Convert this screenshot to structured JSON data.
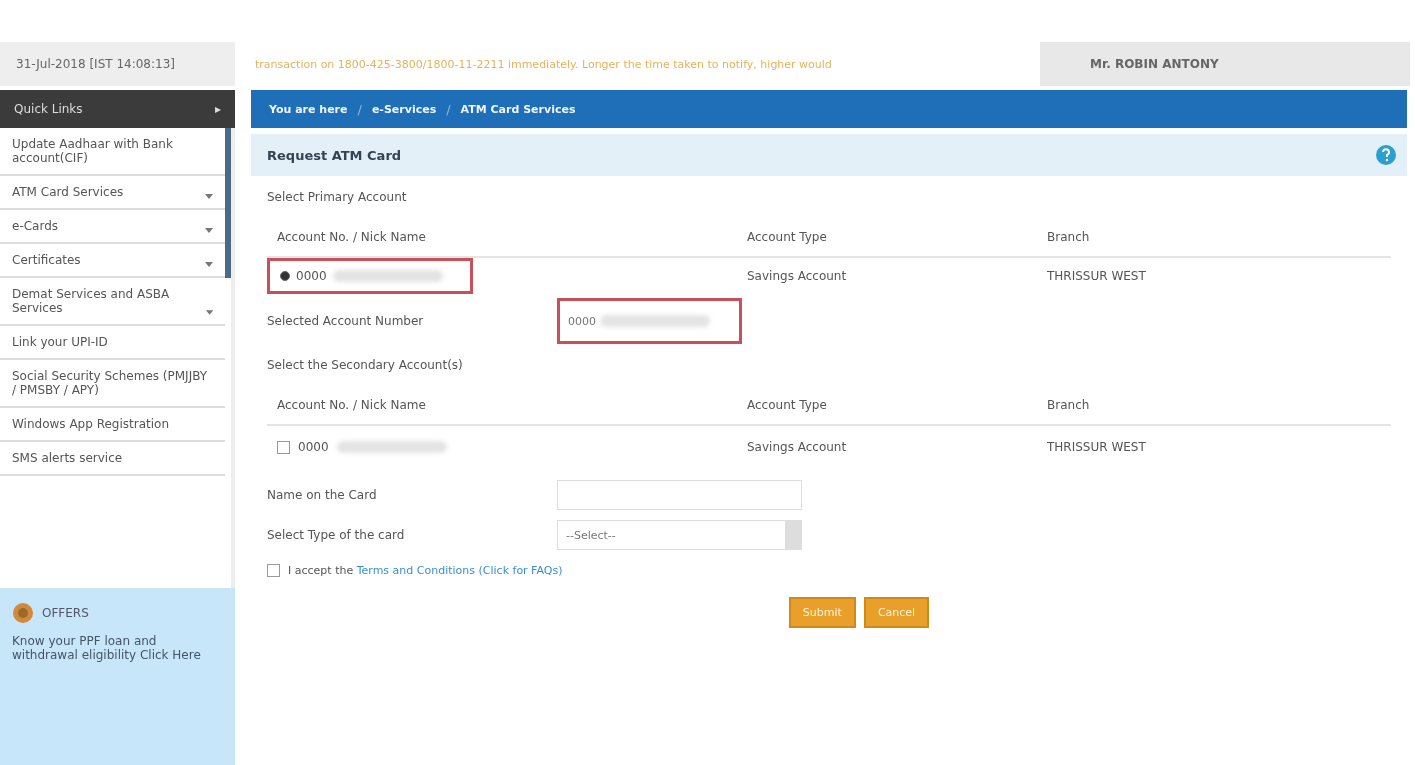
{
  "header": {
    "datetime": "31-Jul-2018 [IST 14:08:13]",
    "notice": "transaction on 1800-425-3800/1800-11-2211 immediately. Longer the time taken to notify, higher would",
    "user": "Mr. ROBIN ANTONY"
  },
  "sidebar": {
    "title": "Quick Links",
    "toggle": "▸",
    "items": [
      {
        "label": "Update Aadhaar with Bank account(CIF)",
        "expandable": false
      },
      {
        "label": "ATM Card Services",
        "expandable": true
      },
      {
        "label": "e-Cards",
        "expandable": true
      },
      {
        "label": "Certificates",
        "expandable": true
      },
      {
        "label": "Demat Services and ASBA Services",
        "expandable": true
      },
      {
        "label": "Link your UPI-ID",
        "expandable": false
      },
      {
        "label": "Social Security Schemes (PMJJBY / PMSBY / APY)",
        "expandable": false
      },
      {
        "label": "Windows App Registration",
        "expandable": false
      },
      {
        "label": "SMS alerts service",
        "expandable": false
      }
    ],
    "offers": {
      "title": "OFFERS",
      "text": "Know your PPF loan and withdrawal eligibility Click Here"
    }
  },
  "breadcrumb": [
    {
      "kind": "link",
      "text": "You are here"
    },
    {
      "kind": "separator",
      "text": "/"
    },
    {
      "kind": "link",
      "text": "e-Services"
    },
    {
      "kind": "separator",
      "text": "/"
    },
    {
      "kind": "link",
      "text": "ATM Card Services"
    }
  ],
  "panel": {
    "title": "Request ATM Card",
    "primary": {
      "heading": "Select Primary Account",
      "columns": [
        "Account No. / Nick Name",
        "Account Type",
        "Branch"
      ],
      "rows": [
        {
          "account": "0000",
          "type": "Savings Account",
          "branch": "THRISSUR WEST",
          "selected": true,
          "highlighted": true
        }
      ]
    },
    "selected_account": {
      "label": "Selected Account Number",
      "value": "0000",
      "highlighted": true
    },
    "secondary": {
      "heading": "Select the Secondary Account(s)",
      "columns": [
        "Account No. / Nick Name",
        "Account Type",
        "Branch"
      ],
      "rows": [
        {
          "account": "0000",
          "type": "Savings Account",
          "branch": "THRISSUR WEST",
          "checked": false
        }
      ]
    },
    "name_on_card": {
      "label": "Name on the Card"
    },
    "card_type": {
      "label": "Select Type of the card",
      "value": "--Select--"
    },
    "terms": {
      "checked": false,
      "prefix": "I accept the",
      "link": "Terms and Conditions (Click for FAQs)"
    },
    "buttons": [
      "Submit",
      "Cancel"
    ]
  }
}
